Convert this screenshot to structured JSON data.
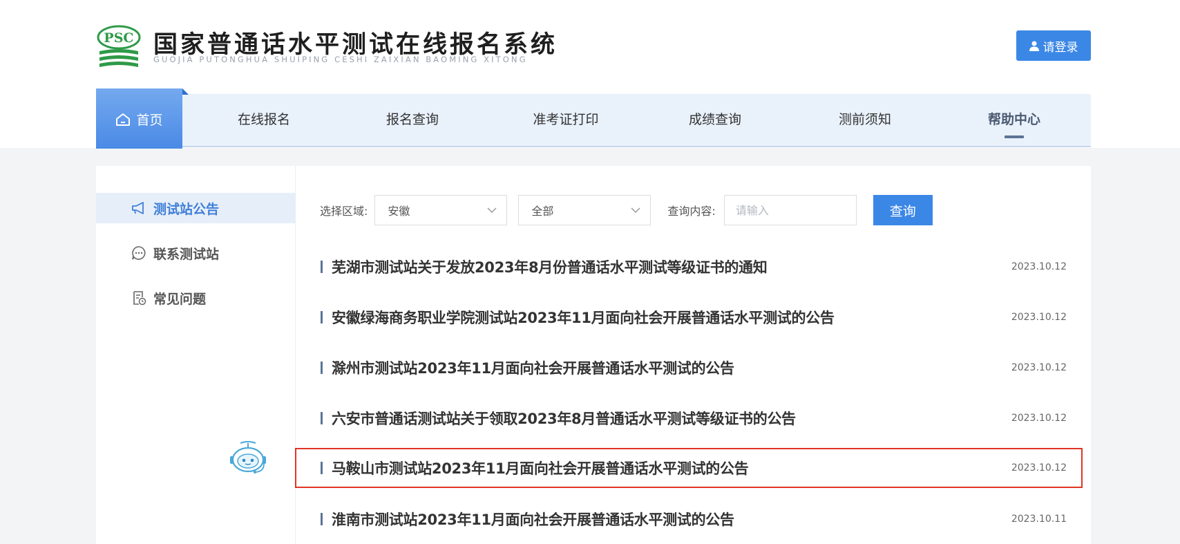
{
  "header": {
    "logo_text": "PSC",
    "title": "国家普通话水平测试在线报名系统",
    "subtitle": "GUOJIA PUTONGHUA SHUIPING CESHI ZAIXIAN BAOMING XITONG",
    "login_label": "请登录"
  },
  "nav": {
    "home_label": "首页",
    "items": [
      {
        "label": "在线报名"
      },
      {
        "label": "报名查询"
      },
      {
        "label": "准考证打印"
      },
      {
        "label": "成绩查询"
      },
      {
        "label": "测前须知"
      },
      {
        "label": "帮助中心",
        "active": true
      }
    ]
  },
  "sidebar": {
    "items": [
      {
        "label": "测试站公告",
        "icon": "megaphone-icon",
        "active": true
      },
      {
        "label": "联系测试站",
        "icon": "chat-bubble-icon"
      },
      {
        "label": "常见问题",
        "icon": "document-clock-icon"
      }
    ]
  },
  "filter": {
    "region_label": "选择区域:",
    "province_value": "安徽",
    "scope_value": "全部",
    "query_label": "查询内容:",
    "query_placeholder": "请输入",
    "query_button": "查询"
  },
  "notices": [
    {
      "title": "芜湖市测试站关于发放2023年8月份普通话水平测试等级证书的通知",
      "date": "2023.10.12"
    },
    {
      "title": "安徽绿海商务职业学院测试站2023年11月面向社会开展普通话水平测试的公告",
      "date": "2023.10.12"
    },
    {
      "title": "滁州市测试站2023年11月面向社会开展普通话水平测试的公告",
      "date": "2023.10.12"
    },
    {
      "title": "六安市普通话测试站关于领取2023年8月普通话水平测试等级证书的公告",
      "date": "2023.10.12"
    },
    {
      "title": "马鞍山市测试站2023年11月面向社会开展普通话水平测试的公告",
      "date": "2023.10.12",
      "highlighted": true
    },
    {
      "title": "淮南市测试站2023年11月面向社会开展普通话水平测试的公告",
      "date": "2023.10.11"
    }
  ],
  "colors": {
    "accent": "#3b87e6",
    "nav_bg": "#e9f1fb",
    "highlight_border": "#e03524",
    "logo_green": "#2e9a48"
  }
}
